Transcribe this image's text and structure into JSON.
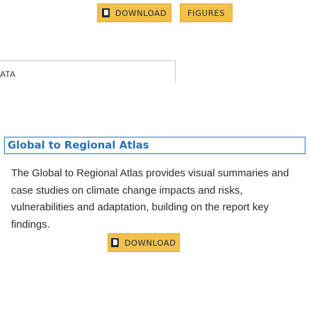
{
  "top_actions": {
    "download_label": "DOWNLOAD",
    "figures_label": "FIGURES"
  },
  "data_section": {
    "label": "ATA"
  },
  "atlas": {
    "title": "Global to Regional Atlas",
    "description": "The Global to Regional Atlas provides visual summaries and case studies on climate change impacts and risks, vulnerabilities and adaptation, building on the report key findings.",
    "download_label": "DOWNLOAD"
  },
  "icons": {
    "download": "document-icon"
  },
  "colors": {
    "button_bg": "#f2c14a",
    "title_link": "#2a6fba"
  }
}
